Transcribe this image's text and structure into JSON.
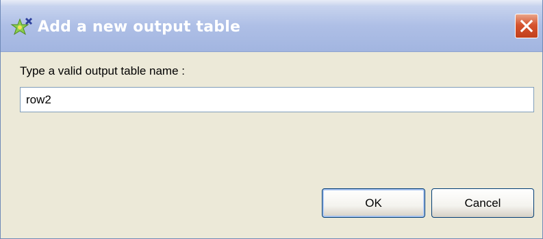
{
  "window": {
    "title": "Add a new output table",
    "title_icon": "add-table-icon",
    "close_icon": "close-icon"
  },
  "form": {
    "prompt_label": "Type a valid output table name :",
    "table_name_value": "row2",
    "table_name_placeholder": ""
  },
  "buttons": {
    "ok_label": "OK",
    "cancel_label": "Cancel"
  },
  "colors": {
    "dialog_background": "#ece9d8",
    "titlebar": "#aebfe6",
    "close_button": "#d6542f",
    "input_border": "#7f9db9"
  }
}
